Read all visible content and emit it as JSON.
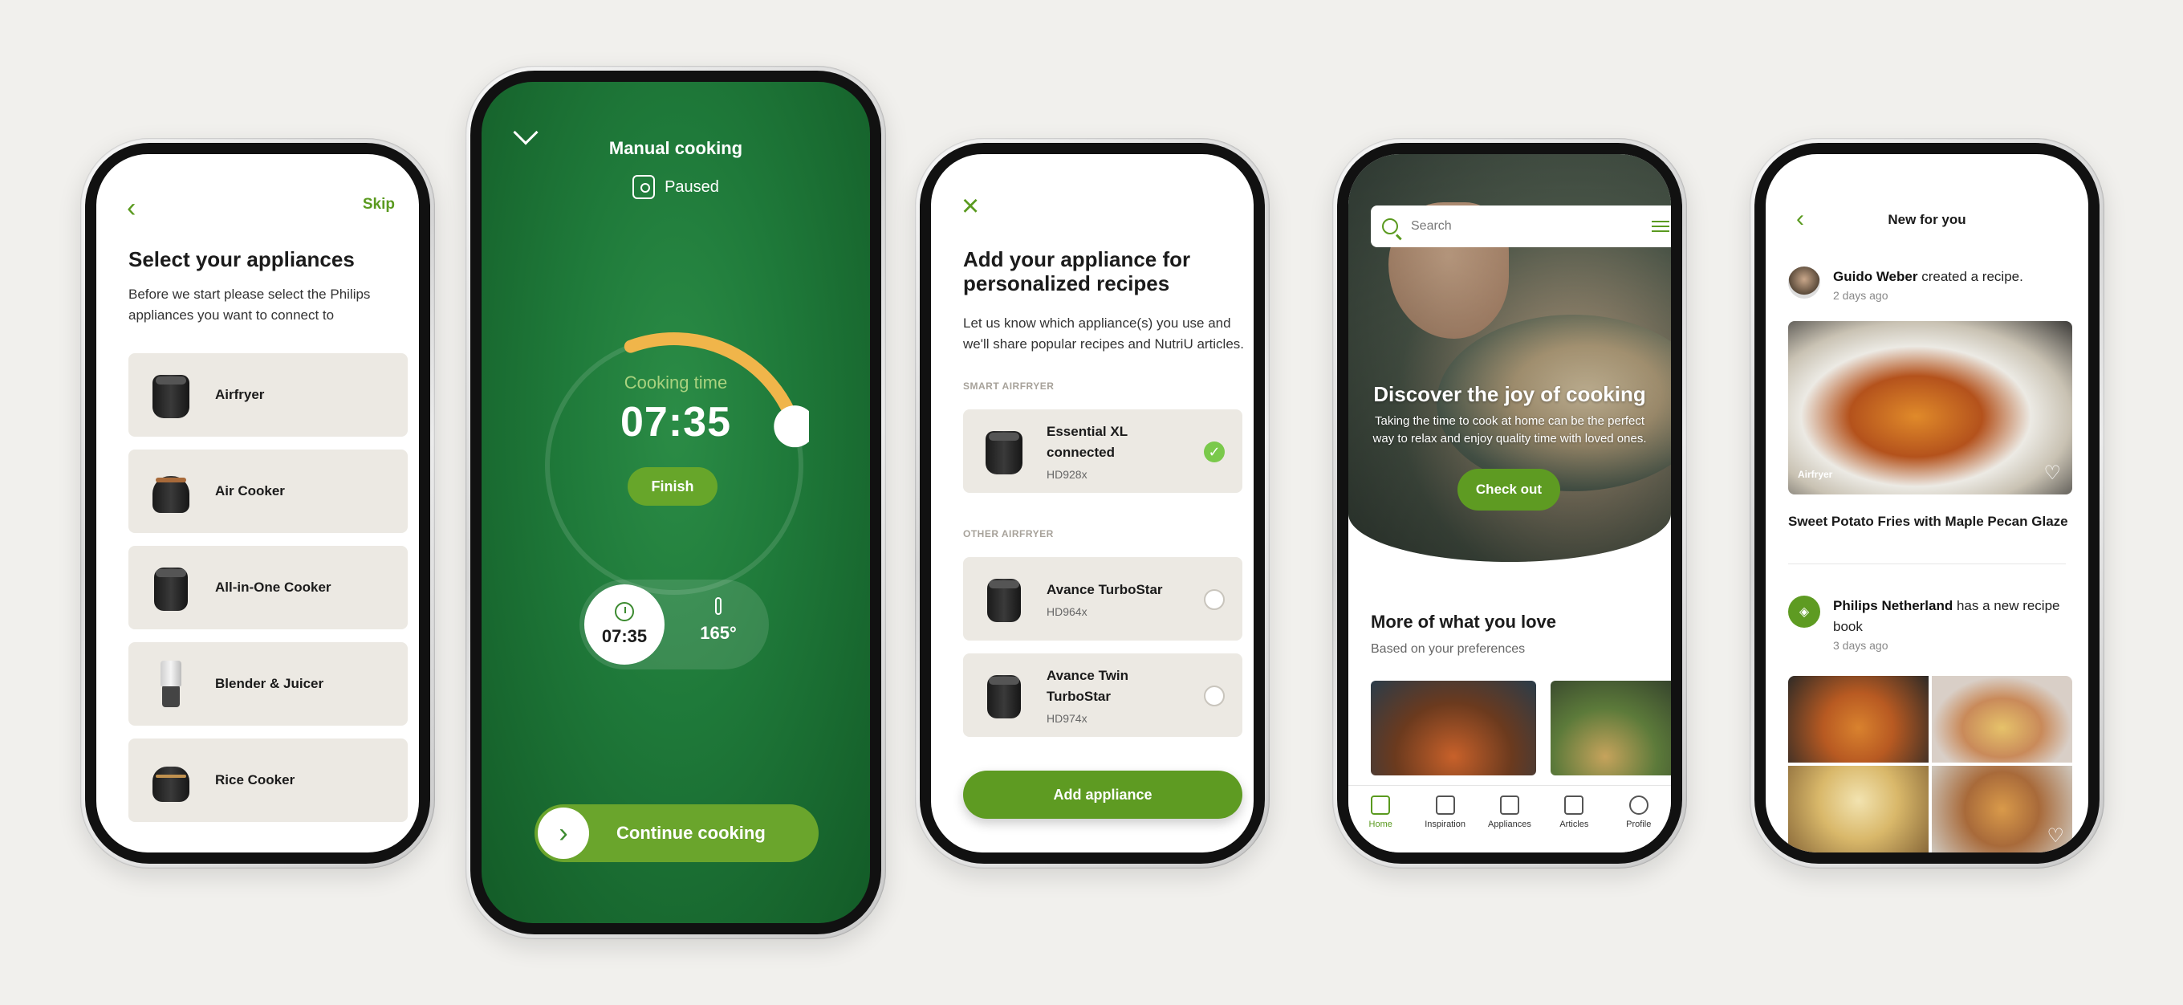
{
  "colors": {
    "accent": "#5e9b22",
    "card_bg": "#ece9e3",
    "cooking_bg": "#1f7a3a",
    "progress": "#f0b54a"
  },
  "screen1": {
    "back_icon": "chevron-left-icon",
    "skip": "Skip",
    "title": "Select your appliances",
    "subtitle": "Before we start please select the Philips appliances you want to connect to",
    "items": [
      {
        "label": "Airfryer"
      },
      {
        "label": "Air Cooker"
      },
      {
        "label": "All-in-One Cooker"
      },
      {
        "label": "Blender & Juicer"
      },
      {
        "label": "Rice Cooker"
      }
    ]
  },
  "screen2": {
    "title": "Manual cooking",
    "status": "Paused",
    "cooking_label": "Cooking time",
    "cooking_time": "07:35",
    "progress": 0.2,
    "finish": "Finish",
    "timer_value": "07:35",
    "temperature": "165°",
    "continue": "Continue cooking"
  },
  "screen3": {
    "title": "Add your appliance for personalized recipes",
    "subtitle": "Let us know which appliance(s) you use and we'll share popular recipes and NutriU articles.",
    "section_smart": "SMART AIRFRYER",
    "section_other": "OTHER AIRFRYER",
    "smart": {
      "name": "Essential XL connected",
      "model": "HD928x",
      "selected": true
    },
    "others": [
      {
        "name": "Avance TurboStar",
        "model": "HD964x",
        "selected": false
      },
      {
        "name": "Avance Twin TurboStar",
        "model": "HD974x",
        "selected": false
      }
    ],
    "add_button": "Add appliance"
  },
  "screen4": {
    "search_placeholder": "Search",
    "hero_title": "Discover the joy of cooking",
    "hero_subtitle": "Taking the time to cook at home can be the perfect way to relax and enjoy quality time with loved ones.",
    "cta": "Check out",
    "section_title": "More of what you love",
    "section_subtitle": "Based on your preferences",
    "nav": [
      {
        "label": "Home",
        "icon": "home-icon",
        "active": true
      },
      {
        "label": "Inspiration",
        "icon": "chef-hat-icon",
        "active": false
      },
      {
        "label": "Appliances",
        "icon": "grid-icon",
        "active": false
      },
      {
        "label": "Articles",
        "icon": "article-icon",
        "active": false
      },
      {
        "label": "Profile",
        "icon": "profile-icon",
        "active": false
      }
    ]
  },
  "screen5": {
    "title": "New for you",
    "post1": {
      "author": "Guido Weber",
      "action": " created a recipe.",
      "ago": "2 days ago"
    },
    "post1_tag": "Airfryer",
    "recipe_name": "Sweet Potato Fries with Maple Pecan Glaze",
    "post2": {
      "author": "Philips Netherland",
      "action": " has a new recipe book",
      "ago": "3 days ago"
    }
  }
}
